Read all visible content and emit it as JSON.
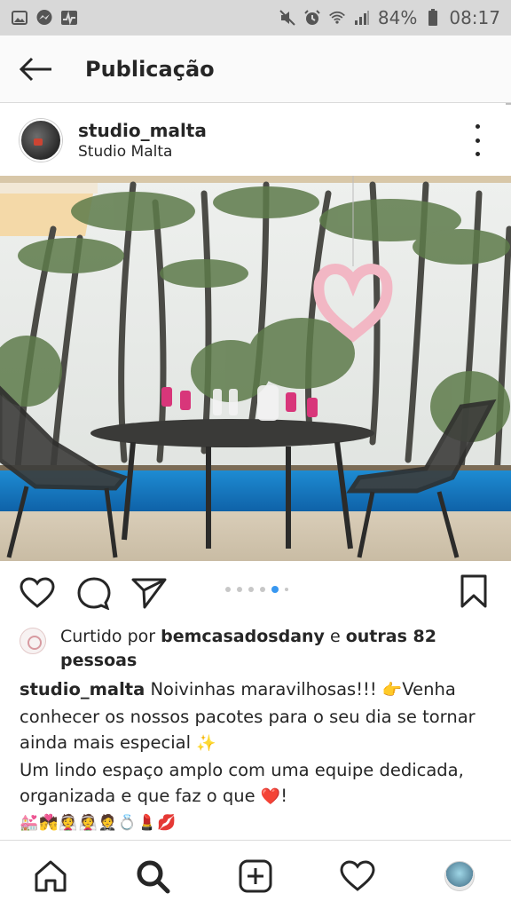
{
  "status_bar": {
    "battery": "84%",
    "time": "08:17",
    "icons_left": [
      "gallery-icon",
      "messenger-icon",
      "activity-icon"
    ],
    "icons_right": [
      "mute-icon",
      "alarm-icon",
      "wifi-icon",
      "signal-icon",
      "battery-icon"
    ]
  },
  "header": {
    "title": "Publicação"
  },
  "post": {
    "username": "studio_malta",
    "display_name": "Studio Malta",
    "carousel": {
      "count": 6,
      "active_index": 4
    },
    "likes": {
      "prefix": "Curtido por",
      "liked_by": "bemcasadosdany",
      "connector": "e",
      "others_line1": "outras 82",
      "others_line2": "pessoas"
    },
    "caption": {
      "line1_text": " Noivinhas maravilhosas!!! ",
      "line1_emoji": "👉",
      "line1_tail": "Venha",
      "line2": "conhecer os nossos pacotes para o seu dia se tornar",
      "line3_text": "ainda mais especial ",
      "line3_emoji": "✨",
      "line4": "Um lindo espaço amplo com uma equipe dedicada,",
      "line5_text": "organizada e que faz o que ",
      "line5_emoji": "❤️",
      "line5_tail": "!",
      "line6_emoji": "💒💏👰👰🤵💍💄💋"
    }
  },
  "bottom_nav": [
    "home-icon",
    "search-icon",
    "add-post-icon",
    "activity-heart-icon",
    "profile-avatar"
  ]
}
